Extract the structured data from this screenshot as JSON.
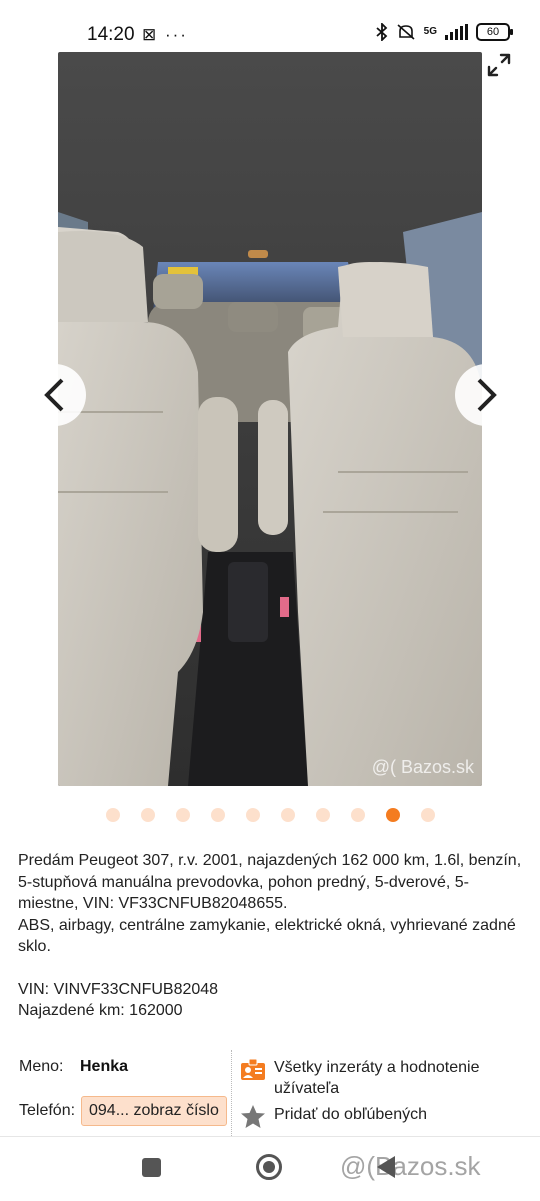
{
  "status_bar": {
    "time": "14:20",
    "left_icons": "⊠ ···",
    "network": "5G",
    "battery": "60"
  },
  "gallery": {
    "watermark": "@( Bazos.sk",
    "photo_count": 10,
    "active_photo_index": 8
  },
  "description": {
    "line1": "Predám Peugeot 307, r.v. 2001, najazdených 162 000 km, 1.6l, benzín, 5-stupňová manuálna prevodovka, pohon predný, 5-dverové, 5-miestne, VIN: VF33CNFUB82048655.",
    "line2": "ABS, airbagy, centrálne zamykanie, elektrické okná, vyhrievané zadné sklo.",
    "vin": "VIN: VINVF33CNFUB82048",
    "km": "Najazdené km: 162000"
  },
  "contact": {
    "name_label": "Meno:",
    "name_value": "Henka",
    "phone_label": "Telefón:",
    "phone_button": "094... zobraz číslo",
    "all_ads": "Všetky inzeráty a hodnotenie užívateľa",
    "add_favorite": "Pridať do obľúbených"
  },
  "bottom_nav": {
    "watermark": "@(Bazos.sk"
  },
  "colors": {
    "accent": "#f47c20",
    "dot_inactive": "#fde0cc",
    "phone_bg": "#fde0cc"
  }
}
